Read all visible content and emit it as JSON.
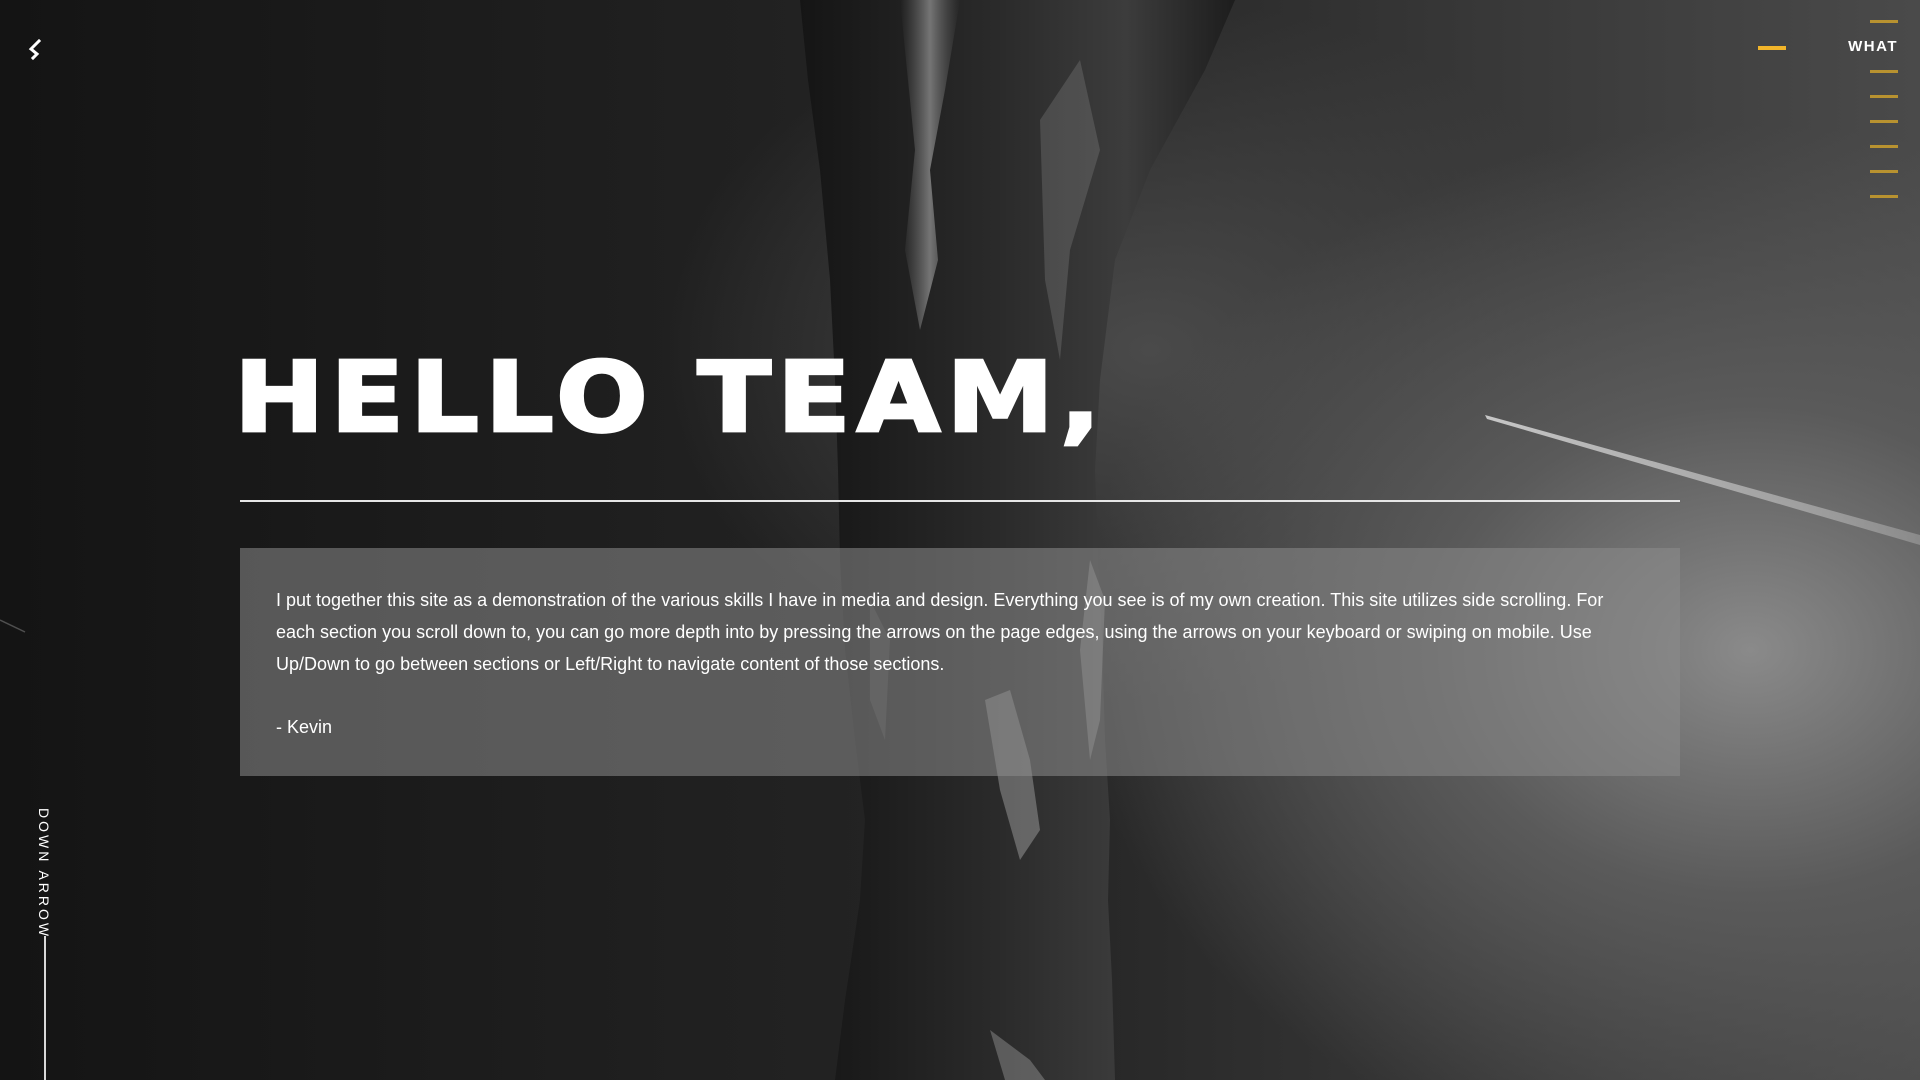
{
  "header": {
    "back_icon": "chevron-left-icon"
  },
  "nav": {
    "active_label": "WHAT",
    "accent_color": "#f2b52a",
    "line_color": "#b89230"
  },
  "main": {
    "heading": "HELLO TEAM,",
    "intro": "I put together this site as a demonstration of the various skills I have in media and design. Everything you see is of my own creation. This site utilizes side scrolling. For each section you scroll down to, you can go more depth into by pressing the arrows on the page edges, using the arrows on your keyboard or swiping on mobile. Use Up/Down to go between sections or Left/Right to navigate content of those sections.",
    "signature": "- Kevin"
  },
  "footer": {
    "down_arrow_label": "DOWN ARROW"
  }
}
